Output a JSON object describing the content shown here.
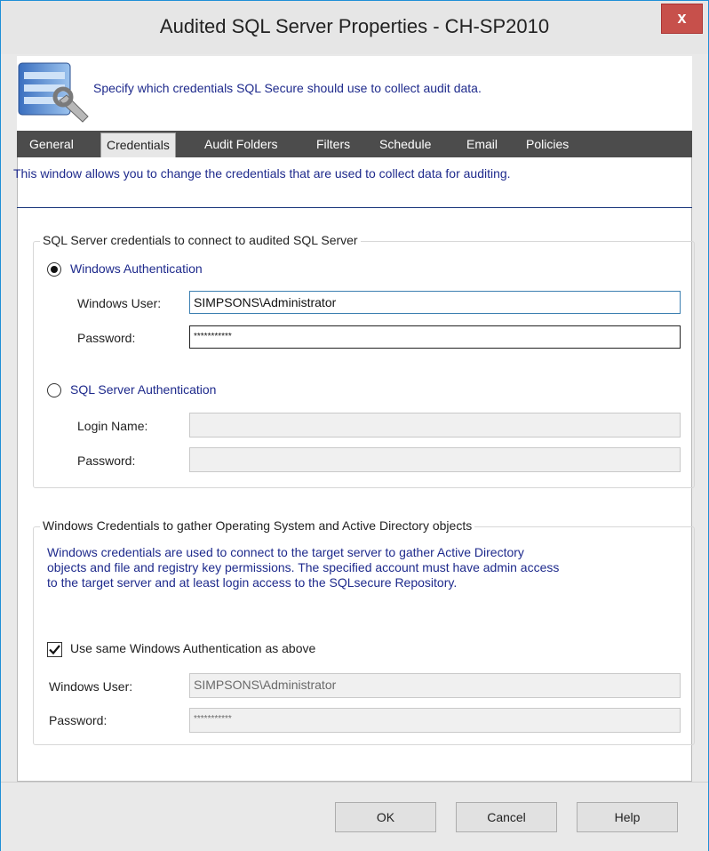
{
  "window": {
    "title": "Audited SQL Server Properties - CH-SP2010",
    "close_label": "x"
  },
  "header": {
    "text": "Specify which credentials SQL Secure should use to collect audit data."
  },
  "tabs": [
    {
      "label": "General",
      "active": false
    },
    {
      "label": "Credentials",
      "active": true
    },
    {
      "label": "Audit Folders",
      "active": false
    },
    {
      "label": "Filters",
      "active": false
    },
    {
      "label": "Schedule",
      "active": false
    },
    {
      "label": "Email",
      "active": false
    },
    {
      "label": "Policies",
      "active": false
    }
  ],
  "content": {
    "description": "This window allows you to change the credentials that are used to collect data for auditing."
  },
  "sql_group": {
    "legend": "SQL Server credentials to connect to audited SQL Server",
    "windows_auth": {
      "label": "Windows Authentication",
      "selected": true
    },
    "windows_user_label": "Windows User:",
    "windows_user_value": "SIMPSONS\\Administrator",
    "password_label": "Password:",
    "password_value": "***********",
    "sql_auth": {
      "label": "SQL Server Authentication",
      "selected": false
    },
    "login_name_label": "Login Name:",
    "login_name_value": "",
    "sql_password_label": "Password:",
    "sql_password_value": ""
  },
  "win_group": {
    "legend": "Windows Credentials to gather Operating System and Active Directory objects",
    "note_lines": [
      "Windows credentials are used to connect to the target server to gather Active Directory",
      "objects and file and registry key permissions. The specified account must have admin access",
      "to the target server and at least login access to the SQLsecure Repository."
    ],
    "use_same_label": "Use same Windows Authentication as above",
    "use_same_checked": true,
    "windows_user_label": "Windows User:",
    "windows_user_value": "SIMPSONS\\Administrator",
    "password_label": "Password:",
    "password_value": "***********"
  },
  "buttons": {
    "ok": "OK",
    "cancel": "Cancel",
    "help": "Help"
  }
}
